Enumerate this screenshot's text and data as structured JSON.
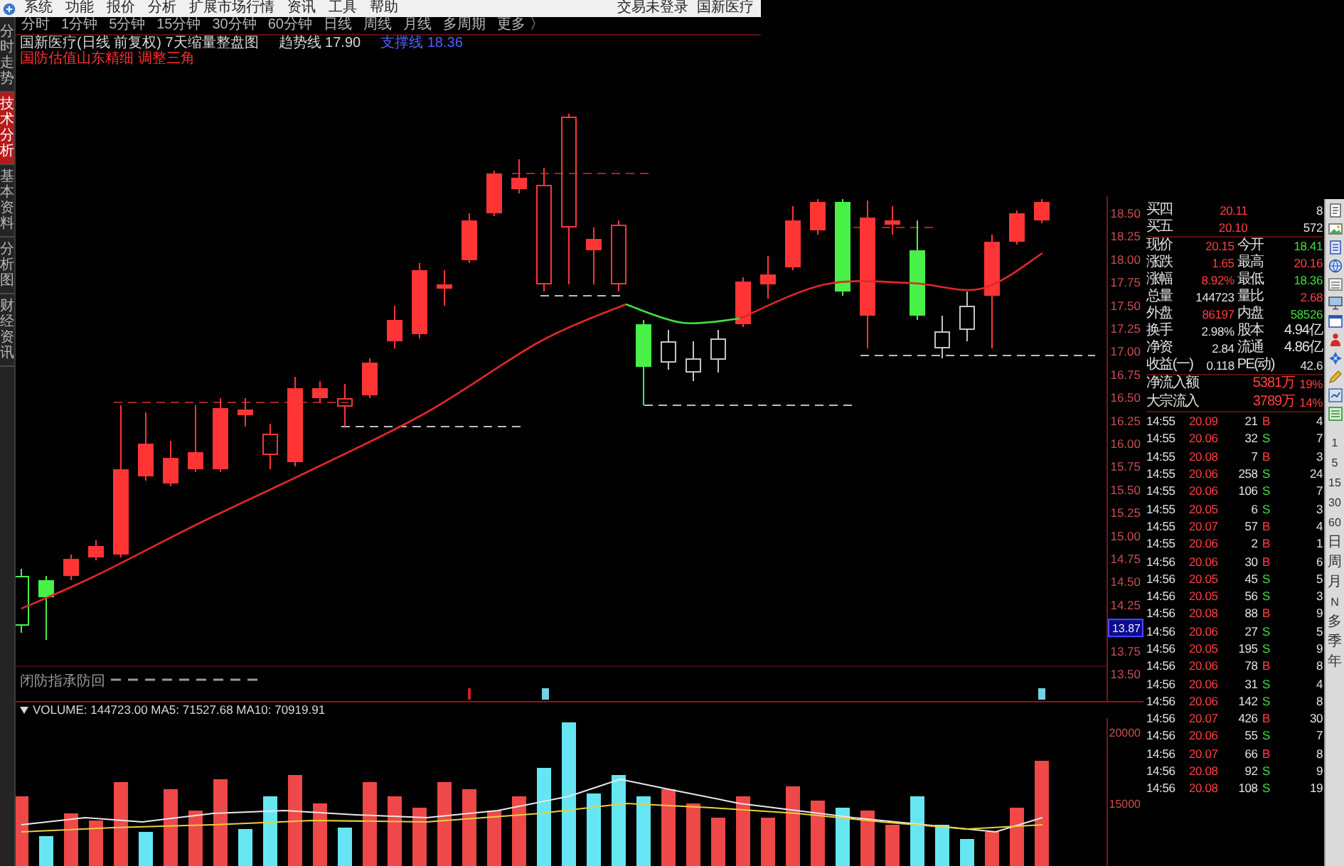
{
  "menu_bar": {
    "items": [
      "系统",
      "功能",
      "报价",
      "分析",
      "扩展市场行情",
      "资讯",
      "工具",
      "帮助"
    ],
    "status": [
      "交易未登录",
      "国新医疗"
    ]
  },
  "period_bar": [
    "分时",
    "1分钟",
    "5分钟",
    "15分钟",
    "30分钟",
    "60分钟",
    "日线",
    "周线",
    "月线",
    "多周期",
    "更多 〉"
  ],
  "side_tabs": [
    {
      "label": "分时走势",
      "selected": false
    },
    {
      "label": "技术分析",
      "selected": true
    },
    {
      "label": "基本资料",
      "selected": false
    },
    {
      "label": "分析图",
      "selected": false
    },
    {
      "label": "财经资讯",
      "selected": false
    }
  ],
  "chart": {
    "title": "国新医疗(日线 前复权) 7天缩量整盘图",
    "indicators": [
      {
        "text": "趋势线 17.90",
        "kind": "plain"
      },
      {
        "text": "支撑线 18.36",
        "kind": "highlight"
      }
    ],
    "note": "国防估值山东精细 调整三角",
    "price_axis": [
      {
        "text": "18.50",
        "kind": "tick"
      },
      {
        "text": "18.25",
        "kind": "tick"
      },
      {
        "text": "18.00",
        "kind": "tick"
      },
      {
        "text": "17.75",
        "kind": "tick"
      },
      {
        "text": "17.50",
        "kind": "tick"
      },
      {
        "text": "17.25",
        "kind": "tick"
      },
      {
        "text": "17.00",
        "kind": "tick"
      },
      {
        "text": "16.75",
        "kind": "tick"
      },
      {
        "text": "16.50",
        "kind": "tick"
      },
      {
        "text": "16.25",
        "kind": "tick"
      },
      {
        "text": "16.00",
        "kind": "tick"
      },
      {
        "text": "15.75",
        "kind": "tick"
      },
      {
        "text": "15.50",
        "kind": "tick"
      },
      {
        "text": "15.25",
        "kind": "tick"
      },
      {
        "text": "15.00",
        "kind": "tick"
      },
      {
        "text": "14.75",
        "kind": "tick"
      },
      {
        "text": "14.50",
        "kind": "tick"
      },
      {
        "text": "14.25",
        "kind": "tick"
      },
      {
        "text": "13.87",
        "kind": "cursor"
      },
      {
        "text": "13.75",
        "kind": "tick"
      },
      {
        "text": "13.50",
        "kind": "tick"
      }
    ],
    "sub_label": "闭防指承防回",
    "volume_legend": "VOLUME: 144723.00 MA5: 71527.68 MA10: 70919.91",
    "volume_axis": [
      "20000",
      "15000"
    ]
  },
  "quote": {
    "bids": [
      {
        "label": "买四",
        "price": "20.11",
        "volume": "8",
        "color": "#ff4040"
      },
      {
        "label": "买五",
        "price": "20.10",
        "volume": "572",
        "color": "#ff4040"
      }
    ],
    "fields": [
      {
        "label": "现价",
        "value": "20.15",
        "color": "#ff4040"
      },
      {
        "label": "今开",
        "value": "18.41",
        "color": "#3ee03e"
      },
      {
        "label": "涨跌",
        "value": "1.65",
        "color": "#ff4040"
      },
      {
        "label": "最高",
        "value": "20.16",
        "color": "#ff4040"
      },
      {
        "label": "涨幅",
        "value": "8.92%",
        "color": "#ff4040"
      },
      {
        "label": "最低",
        "value": "18.36",
        "color": "#3ee03e"
      },
      {
        "label": "总量",
        "value": "144723",
        "color": "#e4e4e4"
      },
      {
        "label": "量比",
        "value": "2.68",
        "color": "#ff4040"
      },
      {
        "label": "外盘",
        "value": "86197",
        "color": "#ff4040"
      },
      {
        "label": "内盘",
        "value": "58526",
        "color": "#3ee03e"
      },
      {
        "label": "换手",
        "value": "2.98%",
        "color": "#e4e4e4"
      },
      {
        "label": "股本",
        "value": "4.94亿",
        "color": "#e4e4e4"
      },
      {
        "label": "净资",
        "value": "2.84",
        "color": "#e4e4e4"
      },
      {
        "label": "流通",
        "value": "4.86亿",
        "color": "#e4e4e4"
      },
      {
        "label": "收益(一)",
        "value": "0.118",
        "color": "#e4e4e4"
      },
      {
        "label": "PE(动)",
        "value": "42.6",
        "color": "#e4e4e4"
      }
    ],
    "flows": [
      {
        "label": "净流入额",
        "value": "5381万",
        "share": "19%",
        "color": "#ff4040"
      },
      {
        "label": "大宗流入",
        "value": "3789万",
        "share": "14%",
        "color": "#ff4040"
      }
    ]
  },
  "trades": [
    {
      "time": "14:55",
      "price": "20.09",
      "volume": "21",
      "side": "B",
      "count": "4",
      "color": "#ff4040"
    },
    {
      "time": "14:55",
      "price": "20.06",
      "volume": "32",
      "side": "S",
      "count": "7",
      "color": "#3ee03e"
    },
    {
      "time": "14:55",
      "price": "20.08",
      "volume": "7",
      "side": "B",
      "count": "3",
      "color": "#ff4040"
    },
    {
      "time": "14:55",
      "price": "20.06",
      "volume": "258",
      "side": "S",
      "count": "24",
      "color": "#3ee03e"
    },
    {
      "time": "14:55",
      "price": "20.06",
      "volume": "106",
      "side": "S",
      "count": "7",
      "color": "#3ee03e"
    },
    {
      "time": "14:55",
      "price": "20.05",
      "volume": "6",
      "side": "S",
      "count": "3",
      "color": "#3ee03e"
    },
    {
      "time": "14:55",
      "price": "20.07",
      "volume": "57",
      "side": "B",
      "count": "4",
      "color": "#ff4040"
    },
    {
      "time": "14:55",
      "price": "20.06",
      "volume": "2",
      "side": "B",
      "count": "1",
      "color": "#ff4040"
    },
    {
      "time": "14:56",
      "price": "20.06",
      "volume": "30",
      "side": "B",
      "count": "6",
      "color": "#ff4040"
    },
    {
      "time": "14:56",
      "price": "20.05",
      "volume": "45",
      "side": "S",
      "count": "5",
      "color": "#3ee03e"
    },
    {
      "time": "14:56",
      "price": "20.05",
      "volume": "56",
      "side": "S",
      "count": "3",
      "color": "#3ee03e"
    },
    {
      "time": "14:56",
      "price": "20.08",
      "volume": "88",
      "side": "B",
      "count": "9",
      "color": "#ff4040"
    },
    {
      "time": "14:56",
      "price": "20.06",
      "volume": "27",
      "side": "S",
      "count": "5",
      "color": "#3ee03e"
    },
    {
      "time": "14:56",
      "price": "20.05",
      "volume": "195",
      "side": "S",
      "count": "9",
      "color": "#3ee03e"
    },
    {
      "time": "14:56",
      "price": "20.06",
      "volume": "78",
      "side": "B",
      "count": "8",
      "color": "#ff4040"
    },
    {
      "time": "14:56",
      "price": "20.06",
      "volume": "31",
      "side": "S",
      "count": "4",
      "color": "#3ee03e"
    },
    {
      "time": "14:56",
      "price": "20.06",
      "volume": "142",
      "side": "S",
      "count": "8",
      "color": "#3ee03e"
    },
    {
      "time": "14:56",
      "price": "20.07",
      "volume": "426",
      "side": "B",
      "count": "30",
      "color": "#ff4040"
    },
    {
      "time": "14:56",
      "price": "20.06",
      "volume": "55",
      "side": "S",
      "count": "7",
      "color": "#3ee03e"
    },
    {
      "time": "14:56",
      "price": "20.07",
      "volume": "66",
      "side": "B",
      "count": "8",
      "color": "#ff4040"
    },
    {
      "time": "14:56",
      "price": "20.08",
      "volume": "92",
      "side": "S",
      "count": "9",
      "color": "#3ee03e"
    },
    {
      "time": "14:56",
      "price": "20.08",
      "volume": "108",
      "side": "S",
      "count": "19",
      "color": "#3ee03e"
    }
  ],
  "tool_strip": [
    "1",
    "5",
    "15",
    "30",
    "60",
    "日",
    "周",
    "月",
    "N",
    "多",
    "季",
    "年"
  ]
}
